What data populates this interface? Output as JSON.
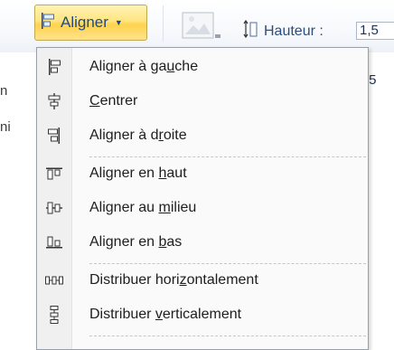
{
  "ribbon": {
    "aligner_label": "Aligner",
    "height_label": "Hauteur :",
    "height_value": "1,5",
    "height_value_2": ",5",
    "side_text_1": "n",
    "side_text_2": "ni"
  },
  "menu": {
    "items": [
      {
        "before": "Aligner à ga",
        "mnemonic": "u",
        "after": "che",
        "icon": "align-left-icon"
      },
      {
        "before": "",
        "mnemonic": "C",
        "after": "entrer",
        "icon": "align-center-icon"
      },
      {
        "before": "Aligner à d",
        "mnemonic": "r",
        "after": "oite",
        "icon": "align-right-icon"
      },
      {
        "before": "Aligner en ",
        "mnemonic": "h",
        "after": "aut",
        "icon": "align-top-icon"
      },
      {
        "before": "Aligner au ",
        "mnemonic": "m",
        "after": "ilieu",
        "icon": "align-middle-icon"
      },
      {
        "before": "Aligner en ",
        "mnemonic": "b",
        "after": "as",
        "icon": "align-bottom-icon"
      },
      {
        "before": "Distribuer hori",
        "mnemonic": "z",
        "after": "ontalement",
        "icon": "distribute-horizontal-icon"
      },
      {
        "before": "Distribuer ",
        "mnemonic": "v",
        "after": "erticalement",
        "icon": "distribute-vertical-icon"
      }
    ]
  },
  "colors": {
    "ribbon_text": "#1f4a85",
    "button_highlight": "#ffe581",
    "menu_background": "#fafafa"
  }
}
